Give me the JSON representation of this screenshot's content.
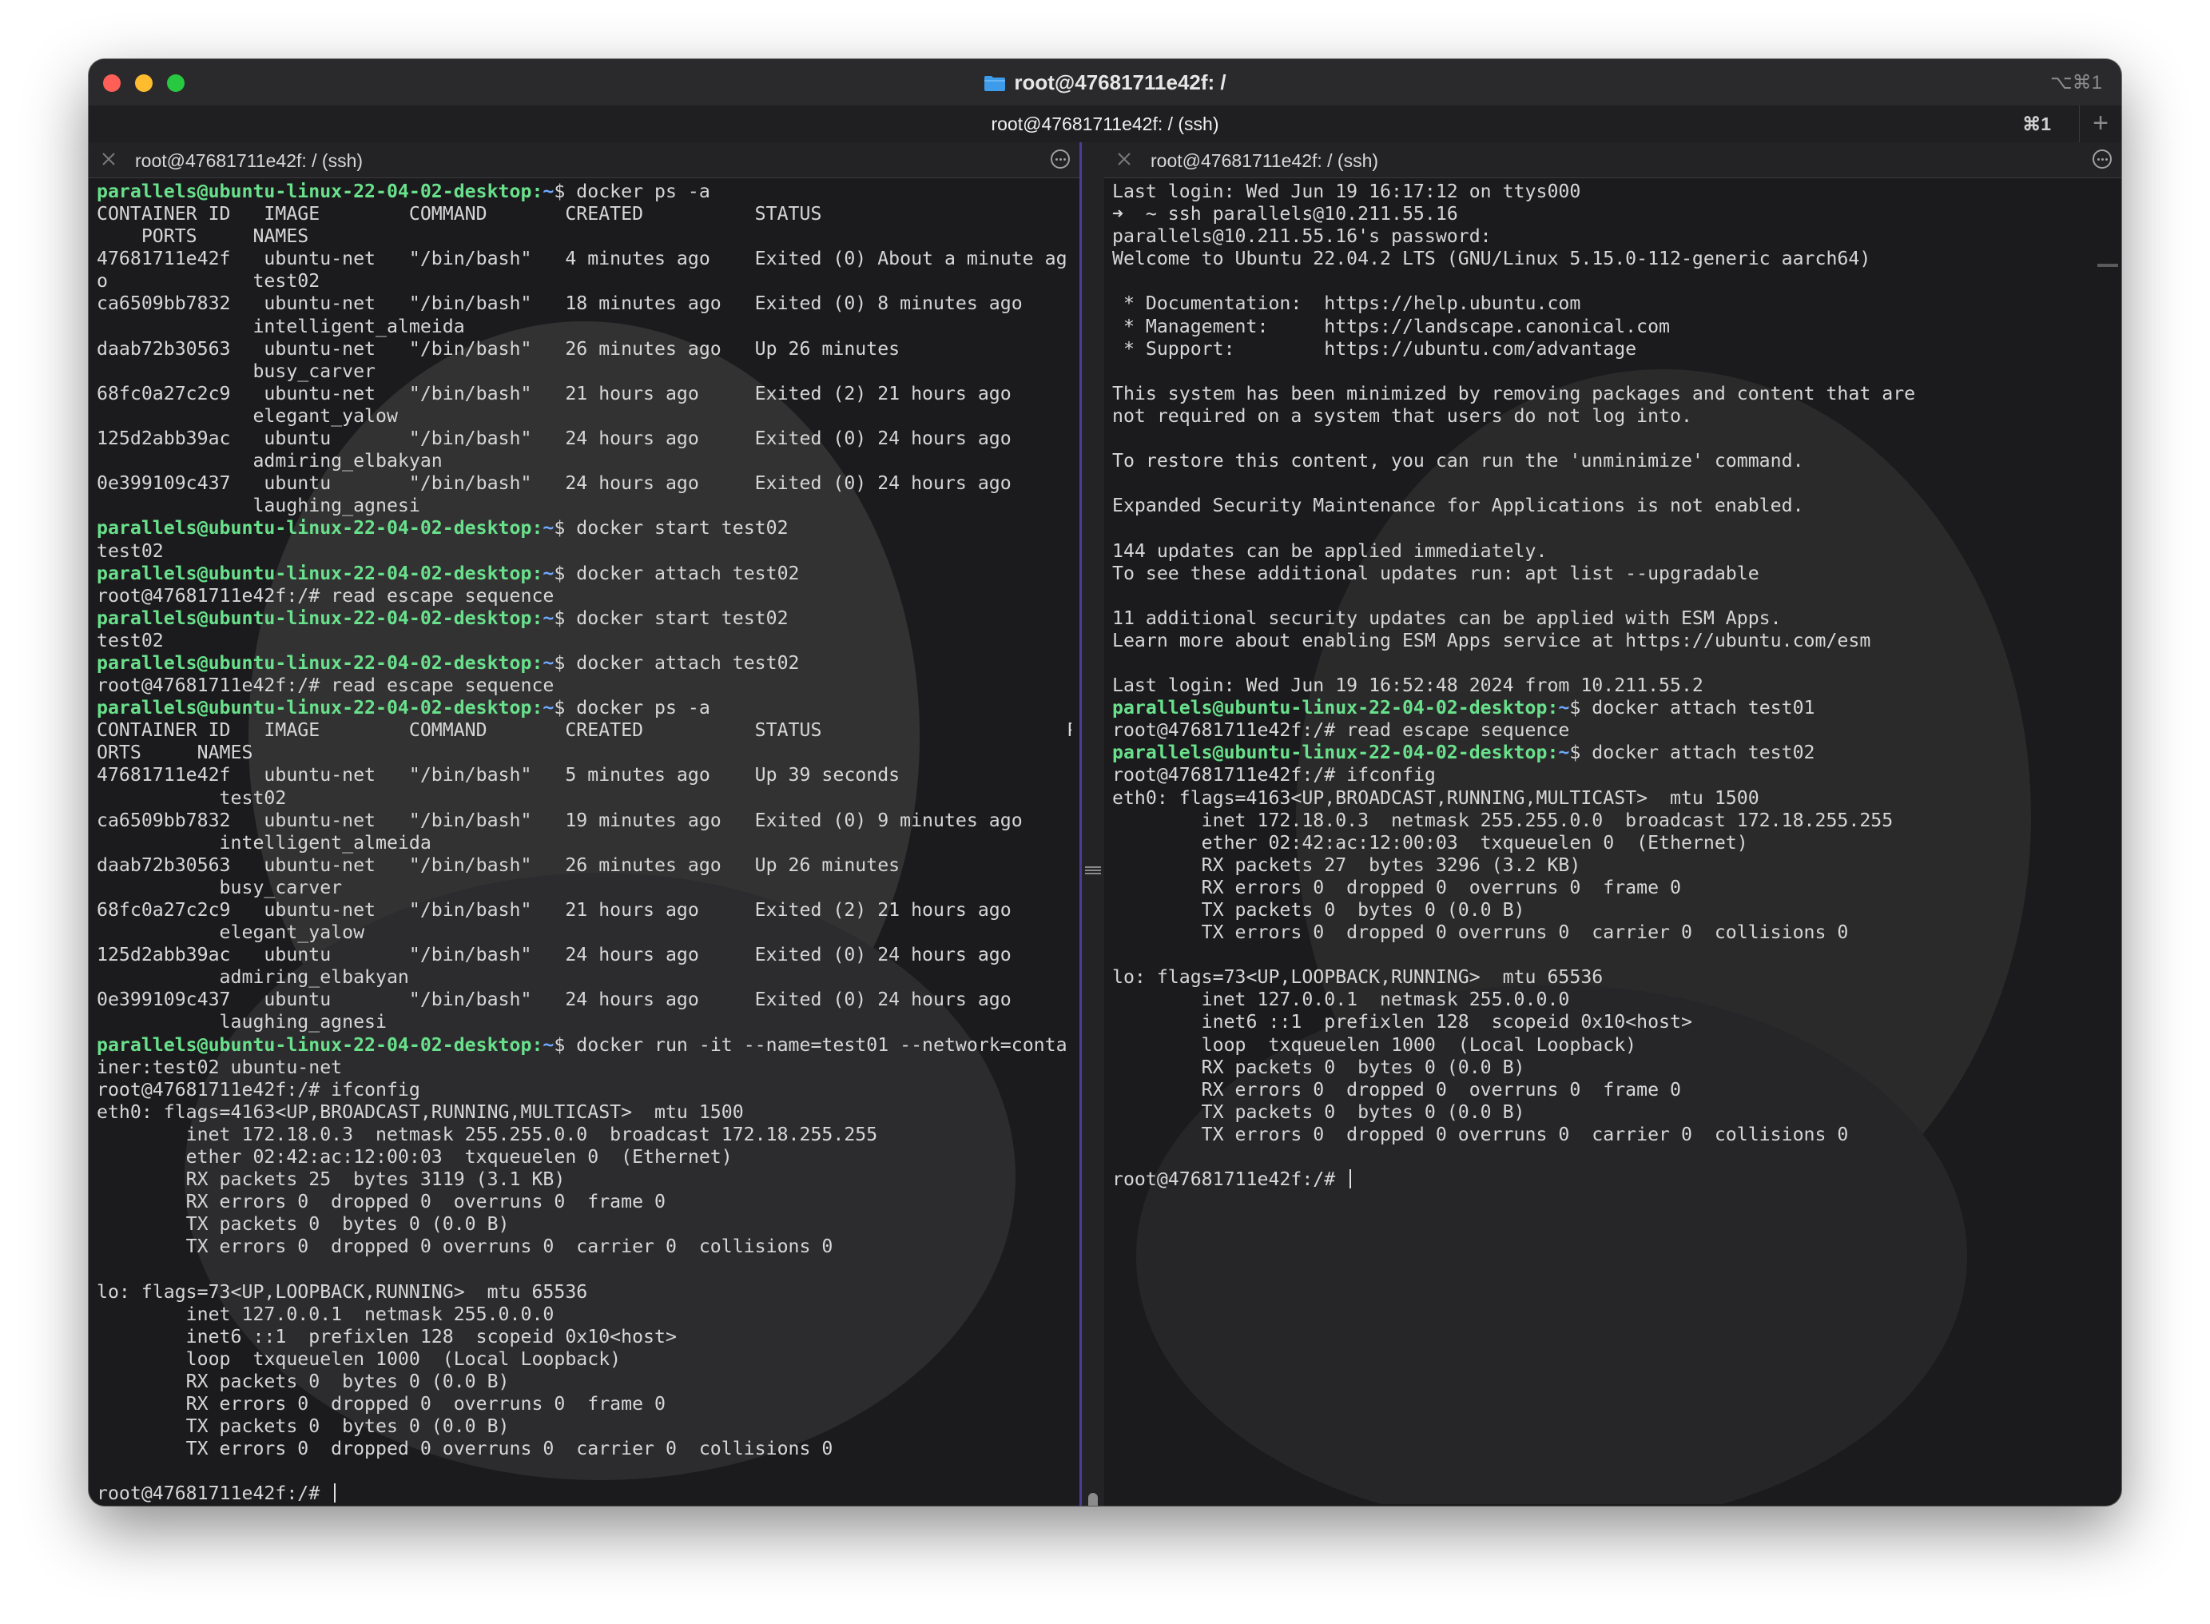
{
  "window": {
    "title": "root@47681711e42f: /",
    "title_shortcut": "⌥⌘1",
    "tab_label": "root@47681711e42f: / (ssh)",
    "tab_shortcut": "⌘1",
    "folder_icon": "folder-icon",
    "colors": {
      "accent_divider": "#4a3d9a",
      "prompt_user": "#69e08b",
      "prompt_path": "#6fa8ff",
      "text": "#d6d6d6"
    }
  },
  "left_pane": {
    "title": "root@47681711e42f: / (ssh)",
    "lines": [
      {
        "u": "parallels@ubuntu-linux-22-04-02-desktop",
        "p": "~",
        "c": "$ docker ps -a"
      },
      {
        "t": "CONTAINER ID   IMAGE        COMMAND       CREATED          STATUS"
      },
      {
        "t": "    PORTS     NAMES"
      },
      {
        "t": "47681711e42f   ubuntu-net   \"/bin/bash\"   4 minutes ago    Exited (0) About a minute ag"
      },
      {
        "t": "o             test02"
      },
      {
        "t": "ca6509bb7832   ubuntu-net   \"/bin/bash\"   18 minutes ago   Exited (0) 8 minutes ago"
      },
      {
        "t": "              intelligent_almeida"
      },
      {
        "t": "daab72b30563   ubuntu-net   \"/bin/bash\"   26 minutes ago   Up 26 minutes"
      },
      {
        "t": "              busy_carver"
      },
      {
        "t": "68fc0a27c2c9   ubuntu-net   \"/bin/bash\"   21 hours ago     Exited (2) 21 hours ago"
      },
      {
        "t": "              elegant_yalow"
      },
      {
        "t": "125d2abb39ac   ubuntu       \"/bin/bash\"   24 hours ago     Exited (0) 24 hours ago"
      },
      {
        "t": "              admiring_elbakyan"
      },
      {
        "t": "0e399109c437   ubuntu       \"/bin/bash\"   24 hours ago     Exited (0) 24 hours ago"
      },
      {
        "t": "              laughing_agnesi"
      },
      {
        "u": "parallels@ubuntu-linux-22-04-02-desktop",
        "p": "~",
        "c": "$ docker start test02"
      },
      {
        "t": "test02"
      },
      {
        "u": "parallels@ubuntu-linux-22-04-02-desktop",
        "p": "~",
        "c": "$ docker attach test02"
      },
      {
        "t": "root@47681711e42f:/# read escape sequence"
      },
      {
        "u": "parallels@ubuntu-linux-22-04-02-desktop",
        "p": "~",
        "c": "$ docker start test02"
      },
      {
        "t": "test02"
      },
      {
        "u": "parallels@ubuntu-linux-22-04-02-desktop",
        "p": "~",
        "c": "$ docker attach test02"
      },
      {
        "t": "root@47681711e42f:/# read escape sequence"
      },
      {
        "u": "parallels@ubuntu-linux-22-04-02-desktop",
        "p": "~",
        "c": "$ docker ps -a"
      },
      {
        "t": "CONTAINER ID   IMAGE        COMMAND       CREATED          STATUS                      P"
      },
      {
        "t": "ORTS     NAMES"
      },
      {
        "t": "47681711e42f   ubuntu-net   \"/bin/bash\"   5 minutes ago    Up 39 seconds"
      },
      {
        "t": "           test02"
      },
      {
        "t": "ca6509bb7832   ubuntu-net   \"/bin/bash\"   19 minutes ago   Exited (0) 9 minutes ago"
      },
      {
        "t": "           intelligent_almeida"
      },
      {
        "t": "daab72b30563   ubuntu-net   \"/bin/bash\"   26 minutes ago   Up 26 minutes"
      },
      {
        "t": "           busy_carver"
      },
      {
        "t": "68fc0a27c2c9   ubuntu-net   \"/bin/bash\"   21 hours ago     Exited (2) 21 hours ago"
      },
      {
        "t": "           elegant_yalow"
      },
      {
        "t": "125d2abb39ac   ubuntu       \"/bin/bash\"   24 hours ago     Exited (0) 24 hours ago"
      },
      {
        "t": "           admiring_elbakyan"
      },
      {
        "t": "0e399109c437   ubuntu       \"/bin/bash\"   24 hours ago     Exited (0) 24 hours ago"
      },
      {
        "t": "           laughing_agnesi"
      },
      {
        "u": "parallels@ubuntu-linux-22-04-02-desktop",
        "p": "~",
        "c": "$ docker run -it --name=test01 --network=conta"
      },
      {
        "t": "iner:test02 ubuntu-net"
      },
      {
        "t": "root@47681711e42f:/# ifconfig"
      },
      {
        "t": "eth0: flags=4163<UP,BROADCAST,RUNNING,MULTICAST>  mtu 1500"
      },
      {
        "t": "        inet 172.18.0.3  netmask 255.255.0.0  broadcast 172.18.255.255"
      },
      {
        "t": "        ether 02:42:ac:12:00:03  txqueuelen 0  (Ethernet)"
      },
      {
        "t": "        RX packets 25  bytes 3119 (3.1 KB)"
      },
      {
        "t": "        RX errors 0  dropped 0  overruns 0  frame 0"
      },
      {
        "t": "        TX packets 0  bytes 0 (0.0 B)"
      },
      {
        "t": "        TX errors 0  dropped 0 overruns 0  carrier 0  collisions 0"
      },
      {
        "t": ""
      },
      {
        "t": "lo: flags=73<UP,LOOPBACK,RUNNING>  mtu 65536"
      },
      {
        "t": "        inet 127.0.0.1  netmask 255.0.0.0"
      },
      {
        "t": "        inet6 ::1  prefixlen 128  scopeid 0x10<host>"
      },
      {
        "t": "        loop  txqueuelen 1000  (Local Loopback)"
      },
      {
        "t": "        RX packets 0  bytes 0 (0.0 B)"
      },
      {
        "t": "        RX errors 0  dropped 0  overruns 0  frame 0"
      },
      {
        "t": "        TX packets 0  bytes 0 (0.0 B)"
      },
      {
        "t": "        TX errors 0  dropped 0 overruns 0  carrier 0  collisions 0"
      },
      {
        "t": ""
      },
      {
        "t": "root@47681711e42f:/# ",
        "cursor": true
      }
    ]
  },
  "right_pane": {
    "title": "root@47681711e42f: / (ssh)",
    "lines": [
      {
        "t": "Last login: Wed Jun 19 16:17:12 on ttys000"
      },
      {
        "t": "➜  ~ ssh parallels@10.211.55.16"
      },
      {
        "t": "parallels@10.211.55.16's password:"
      },
      {
        "t": "Welcome to Ubuntu 22.04.2 LTS (GNU/Linux 5.15.0-112-generic aarch64)"
      },
      {
        "t": ""
      },
      {
        "t": " * Documentation:  https://help.ubuntu.com"
      },
      {
        "t": " * Management:     https://landscape.canonical.com"
      },
      {
        "t": " * Support:        https://ubuntu.com/advantage"
      },
      {
        "t": ""
      },
      {
        "t": "This system has been minimized by removing packages and content that are"
      },
      {
        "t": "not required on a system that users do not log into."
      },
      {
        "t": ""
      },
      {
        "t": "To restore this content, you can run the 'unminimize' command."
      },
      {
        "t": ""
      },
      {
        "t": "Expanded Security Maintenance for Applications is not enabled."
      },
      {
        "t": ""
      },
      {
        "t": "144 updates can be applied immediately."
      },
      {
        "t": "To see these additional updates run: apt list --upgradable"
      },
      {
        "t": ""
      },
      {
        "t": "11 additional security updates can be applied with ESM Apps."
      },
      {
        "t": "Learn more about enabling ESM Apps service at https://ubuntu.com/esm"
      },
      {
        "t": ""
      },
      {
        "t": "Last login: Wed Jun 19 16:52:48 2024 from 10.211.55.2"
      },
      {
        "u": "parallels@ubuntu-linux-22-04-02-desktop",
        "p": "~",
        "c": "$ docker attach test01"
      },
      {
        "t": "root@47681711e42f:/# read escape sequence"
      },
      {
        "u": "parallels@ubuntu-linux-22-04-02-desktop",
        "p": "~",
        "c": "$ docker attach test02"
      },
      {
        "t": "root@47681711e42f:/# ifconfig"
      },
      {
        "t": "eth0: flags=4163<UP,BROADCAST,RUNNING,MULTICAST>  mtu 1500"
      },
      {
        "t": "        inet 172.18.0.3  netmask 255.255.0.0  broadcast 172.18.255.255"
      },
      {
        "t": "        ether 02:42:ac:12:00:03  txqueuelen 0  (Ethernet)"
      },
      {
        "t": "        RX packets 27  bytes 3296 (3.2 KB)"
      },
      {
        "t": "        RX errors 0  dropped 0  overruns 0  frame 0"
      },
      {
        "t": "        TX packets 0  bytes 0 (0.0 B)"
      },
      {
        "t": "        TX errors 0  dropped 0 overruns 0  carrier 0  collisions 0"
      },
      {
        "t": ""
      },
      {
        "t": "lo: flags=73<UP,LOOPBACK,RUNNING>  mtu 65536"
      },
      {
        "t": "        inet 127.0.0.1  netmask 255.0.0.0"
      },
      {
        "t": "        inet6 ::1  prefixlen 128  scopeid 0x10<host>"
      },
      {
        "t": "        loop  txqueuelen 1000  (Local Loopback)"
      },
      {
        "t": "        RX packets 0  bytes 0 (0.0 B)"
      },
      {
        "t": "        RX errors 0  dropped 0  overruns 0  frame 0"
      },
      {
        "t": "        TX packets 0  bytes 0 (0.0 B)"
      },
      {
        "t": "        TX errors 0  dropped 0 overruns 0  carrier 0  collisions 0"
      },
      {
        "t": ""
      },
      {
        "t": "root@47681711e42f:/# ",
        "cursor": true
      }
    ]
  }
}
